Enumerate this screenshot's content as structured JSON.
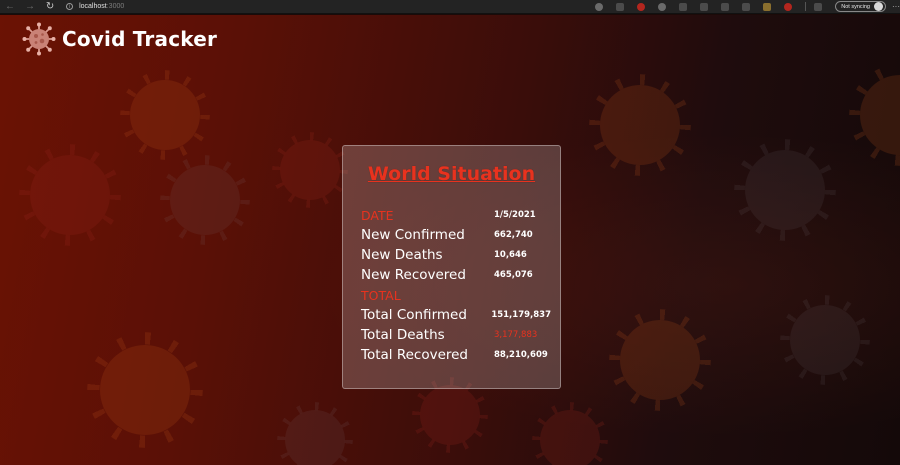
{
  "browser": {
    "address_host": "localhost",
    "address_port": ":3000",
    "profile_label": "Not syncing",
    "more_label": "···"
  },
  "app": {
    "title": "Covid Tracker"
  },
  "card": {
    "title": "World Situation",
    "date_heading": "DATE",
    "date_value": "1/5/2021",
    "new_confirmed_label": "New Confirmed",
    "new_confirmed_value": "662,740",
    "new_deaths_label": "New Deaths",
    "new_deaths_value": "10,646",
    "new_recovered_label": "New Recovered",
    "new_recovered_value": "465,076",
    "total_heading": "TOTAL",
    "total_confirmed_label": "Total Confirmed",
    "total_confirmed_value": "151,179,837",
    "total_deaths_label": "Total Deaths",
    "total_deaths_value": "3,177,883",
    "total_recovered_label": "Total Recovered",
    "total_recovered_value": "88,210,609"
  },
  "colors": {
    "accent_red": "#e8321e",
    "text_white": "#ffffff",
    "page_dark": "#1b0a08"
  }
}
